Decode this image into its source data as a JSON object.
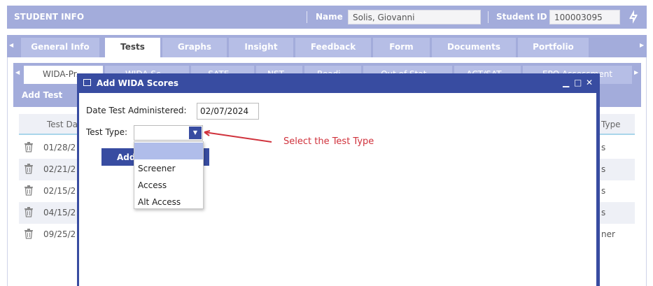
{
  "header": {
    "title": "STUDENT INFO",
    "name_label": "Name",
    "name_value": "Solis, Giovanni",
    "id_label": "Student ID",
    "id_value": "100003095"
  },
  "main_tabs": [
    "General Info",
    "Tests",
    "Graphs",
    "Insight",
    "Feedback",
    "Form",
    "Documents",
    "Portfolio"
  ],
  "active_main_tab": "Tests",
  "sub_tabs": [
    "WIDA-Pr...",
    "WIDA Sc...",
    "SATE...",
    "NST...",
    "Readi...",
    "Out of Stat...",
    "ACT/SAT...",
    "EPO Assessment"
  ],
  "add_test_label": "Add Test",
  "table": {
    "col_date": "Test Da",
    "col_type": "Type",
    "rows": [
      {
        "date": "01/28/2",
        "type": "s"
      },
      {
        "date": "02/21/2",
        "type": "s"
      },
      {
        "date": "02/15/2",
        "type": "s"
      },
      {
        "date": "04/15/2",
        "type": "s"
      },
      {
        "date": "09/25/2",
        "type": "ner"
      }
    ]
  },
  "modal": {
    "title": "Add WIDA Scores",
    "date_label": "Date Test Administered:",
    "date_value": "02/07/2024",
    "type_label": "Test Type:",
    "add_button": "Add",
    "options": [
      "",
      "Screener",
      "Access",
      "Alt Access"
    ]
  },
  "annotation": "Select the Test Type",
  "colors": {
    "accent": "#384ca1",
    "header": "#a3acdb",
    "annotation": "#d0323c"
  }
}
